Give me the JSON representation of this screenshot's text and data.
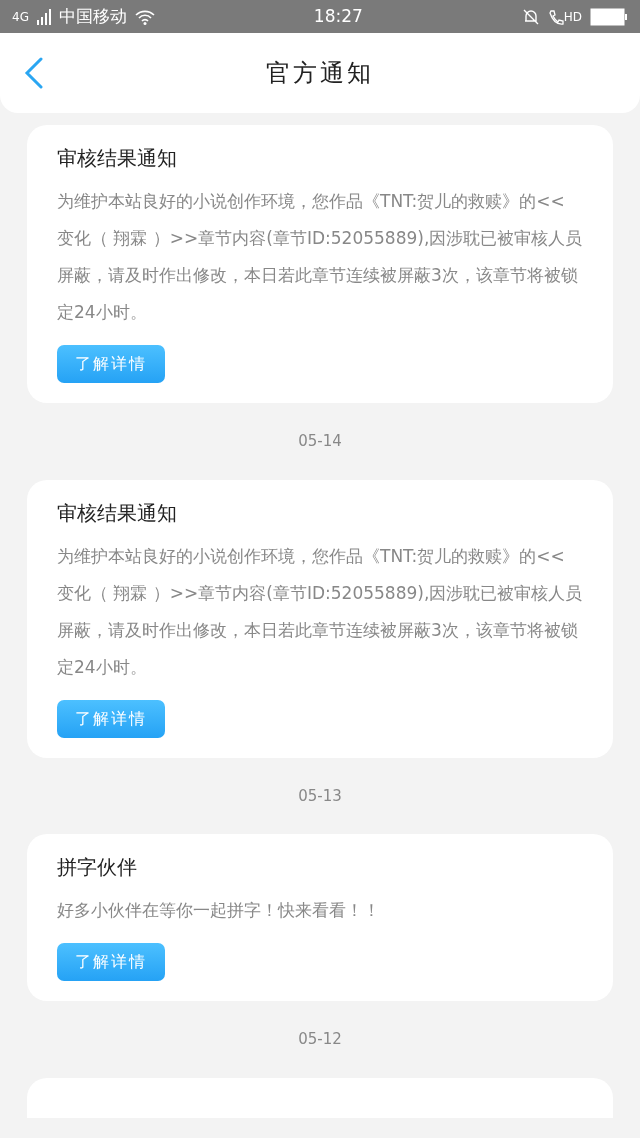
{
  "status_bar": {
    "network": "4G",
    "carrier": "中国移动",
    "time": "18:27",
    "call_badge": "HD"
  },
  "header": {
    "title": "官方通知"
  },
  "notices": [
    {
      "title": "审核结果通知",
      "body": "为维护本站良好的小说创作环境，您作品《TNT:贺儿的救赎》的<< 变化（ 翔霖 ）>>章节内容(章节ID:52055889),因涉耽已被审核人员屏蔽，请及时作出修改，本日若此章节连续被屏蔽3次，该章节将被锁定24小时。",
      "button": "了解详情",
      "date": "05-14"
    },
    {
      "title": "审核结果通知",
      "body": "为维护本站良好的小说创作环境，您作品《TNT:贺儿的救赎》的<< 变化（ 翔霖 ）>>章节内容(章节ID:52055889),因涉耽已被审核人员屏蔽，请及时作出修改，本日若此章节连续被屏蔽3次，该章节将被锁定24小时。",
      "button": "了解详情",
      "date": "05-13"
    },
    {
      "title": "拼字伙伴",
      "body": "好多小伙伴在等你一起拼字！快来看看！！",
      "button": "了解详情",
      "date": "05-12"
    }
  ]
}
